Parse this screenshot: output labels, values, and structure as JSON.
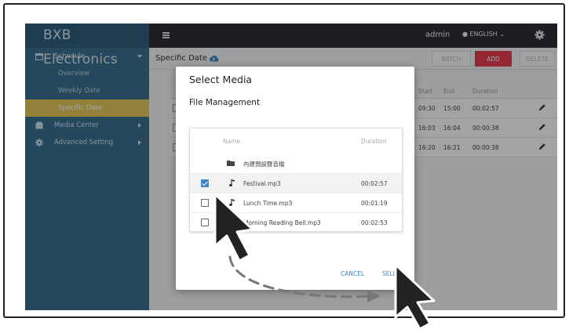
{
  "app": {
    "brand": "BXB Electronics",
    "user": "admin",
    "language": "ENGLISH"
  },
  "sidebar": {
    "items": [
      {
        "label": "Schedule",
        "icon": "calendar-icon"
      },
      {
        "label": "Overview"
      },
      {
        "label": "Weekly Date"
      },
      {
        "label": "Specific Date"
      },
      {
        "label": "Media Center",
        "icon": "media-icon"
      },
      {
        "label": "Advanced Setting",
        "icon": "gear-icon"
      }
    ]
  },
  "page": {
    "title": "Specific Date",
    "buttons": {
      "batch": "BATCH",
      "add": "ADD",
      "delete": "DELETE"
    }
  },
  "bg_table": {
    "headers": {
      "start": "Start",
      "end": "End",
      "duration": "Duration"
    },
    "rows": [
      {
        "start": "09:30",
        "end": "15:00",
        "duration": "00:02:57"
      },
      {
        "start": "16:03",
        "end": "16:04",
        "duration": "00:00:38"
      },
      {
        "start": "16:20",
        "end": "16:21",
        "duration": "00:00:38"
      }
    ]
  },
  "modal": {
    "title": "Select Media",
    "subtitle": "File Management",
    "list_headers": {
      "name": "Name",
      "duration": "Duration"
    },
    "folder": "內建預設聲音檔",
    "files": [
      {
        "name": "Festival.mp3",
        "duration": "00:02:57",
        "checked": true
      },
      {
        "name": "Lunch Time.mp3",
        "duration": "00:01:19",
        "checked": false
      },
      {
        "name": "Morning Reading Bell.mp3",
        "duration": "00:02:53",
        "checked": false
      }
    ],
    "cancel": "CANCEL",
    "select": "SELECT"
  },
  "colors": {
    "sidebar": "#3a6f8f",
    "active_nav": "#e2c75a",
    "topbar": "#2d2f33",
    "add_button": "#e23c4e",
    "accent": "#3b87c8"
  }
}
